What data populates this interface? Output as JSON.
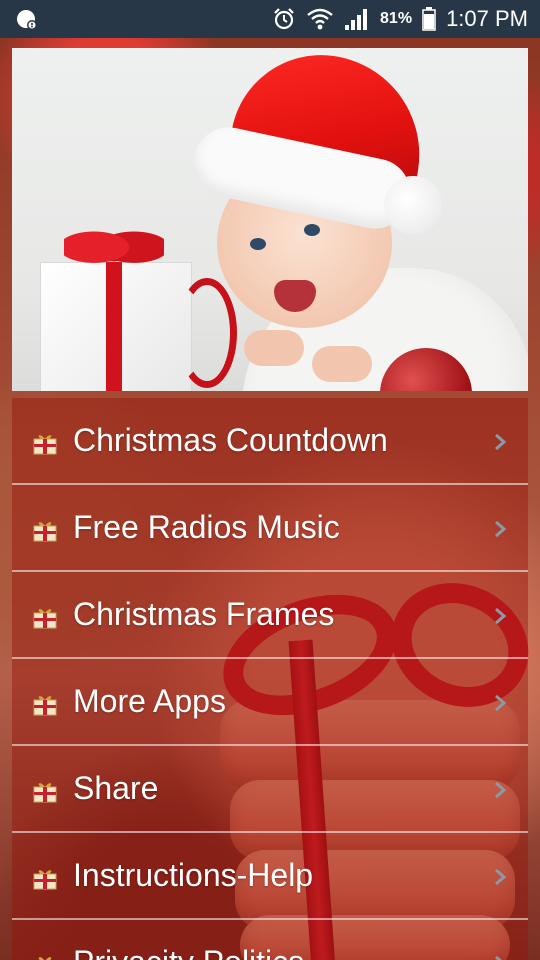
{
  "status_bar": {
    "battery_percent": "81%",
    "time": "1:07 PM",
    "icons": [
      "notification-icon",
      "alarm-icon",
      "wifi-icon",
      "signal-icon",
      "battery-icon"
    ]
  },
  "hero": {
    "image": "baby-in-santa-hat-photo"
  },
  "menu": {
    "items": [
      {
        "label": "Christmas Countdown",
        "icon": "gift-icon"
      },
      {
        "label": "Free Radios Music",
        "icon": "gift-icon"
      },
      {
        "label": "Christmas Frames",
        "icon": "gift-icon"
      },
      {
        "label": "More Apps",
        "icon": "gift-icon"
      },
      {
        "label": "Share",
        "icon": "gift-icon"
      },
      {
        "label": "Instructions-Help",
        "icon": "gift-icon"
      },
      {
        "label": "Privacity Politics",
        "icon": "gift-icon"
      }
    ]
  },
  "colors": {
    "status_bar_bg": "#283747",
    "menu_item_bg": "rgba(150,20,10,0.45)",
    "menu_text": "#ffffff",
    "chevron": "#8a9aa6"
  }
}
